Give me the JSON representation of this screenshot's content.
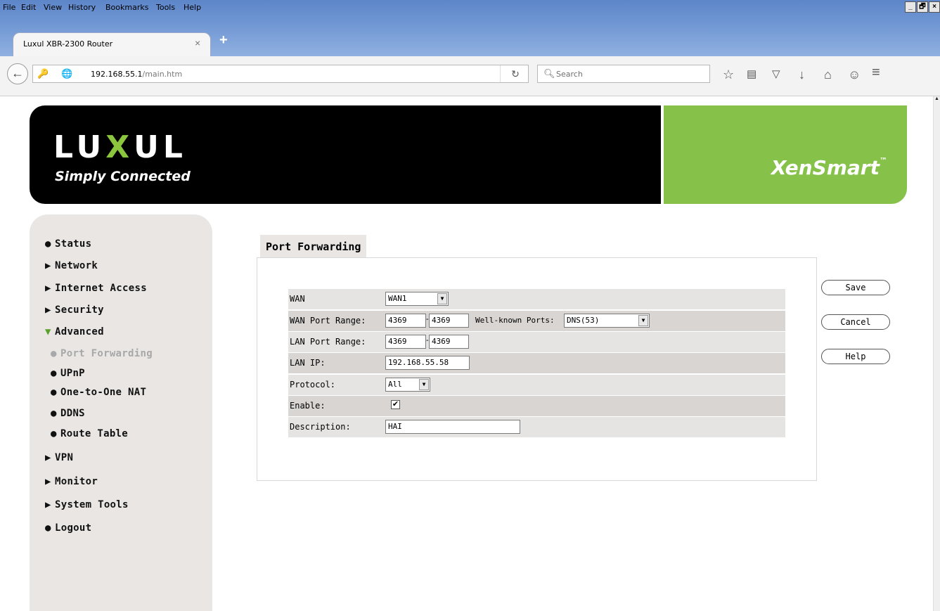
{
  "browser": {
    "menu": [
      "File",
      "Edit",
      "View",
      "History",
      "Bookmarks",
      "Tools",
      "Help"
    ],
    "tab_title": "Luxul XBR-2300 Router",
    "tab_close": "×",
    "new_tab": "+",
    "url_host": "192.168.55.1",
    "url_path": "/main.htm",
    "search_placeholder": "Search",
    "window_buttons": [
      "_",
      "🗗",
      "×"
    ]
  },
  "banner": {
    "logo_part1": "LU",
    "logo_x": "X",
    "logo_part2": "UL",
    "tagline": "Simply Connected",
    "product": "XenSmart",
    "product_tm": "™",
    "green": "#86c14a"
  },
  "sidebar": {
    "items": [
      {
        "marker": "●",
        "label": "Status"
      },
      {
        "marker": "▶",
        "label": "Network"
      },
      {
        "marker": "▶",
        "label": "Internet Access"
      },
      {
        "marker": "▶",
        "label": "Security"
      },
      {
        "marker": "▼",
        "label": "Advanced"
      },
      {
        "marker": "●",
        "label": "Port Forwarding"
      },
      {
        "marker": "●",
        "label": "UPnP"
      },
      {
        "marker": "●",
        "label": "One-to-One NAT"
      },
      {
        "marker": "●",
        "label": "DDNS"
      },
      {
        "marker": "●",
        "label": "Route Table"
      },
      {
        "marker": "▶",
        "label": "VPN"
      },
      {
        "marker": "▶",
        "label": "Monitor"
      },
      {
        "marker": "▶",
        "label": "System Tools"
      },
      {
        "marker": "●",
        "label": "Logout"
      }
    ]
  },
  "section_title": "Port Forwarding",
  "form": {
    "wan_label": "WAN",
    "wan_value": "WAN1",
    "wan_port_label": "WAN Port Range:",
    "wan_port_start": "4369",
    "wan_port_end": "4369",
    "well_known_label": "Well-known Ports:",
    "well_known_value": "DNS(53)",
    "lan_port_label": "LAN Port Range:",
    "lan_port_start": "4369",
    "lan_port_end": "4369",
    "lan_ip_label": "LAN IP:",
    "lan_ip_value": "192.168.55.58",
    "protocol_label": "Protocol:",
    "protocol_value": "All",
    "enable_label": "Enable:",
    "enable_checked": true,
    "description_label": "Description:",
    "description_value": "HAI",
    "dash": "-"
  },
  "buttons": {
    "save": "Save",
    "cancel": "Cancel",
    "help": "Help"
  }
}
